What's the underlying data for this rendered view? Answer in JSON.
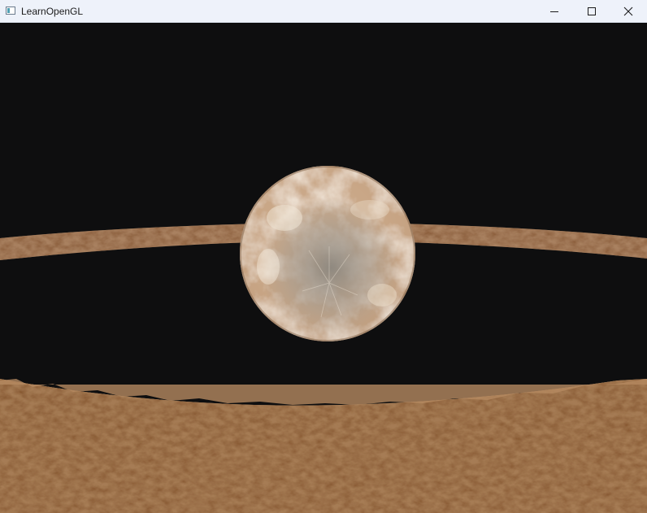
{
  "window": {
    "title": "LearnOpenGL",
    "controls": {
      "minimize": "minimize-icon",
      "maximize": "maximize-icon",
      "close": "close-icon"
    }
  },
  "scene": {
    "background_color": "#0e0e0f",
    "objects": [
      {
        "name": "planet",
        "texture": "planet",
        "base_color": "#d9b897"
      },
      {
        "name": "asteroid-ring",
        "texture": "rock",
        "base_color": "#a57a52"
      }
    ]
  }
}
